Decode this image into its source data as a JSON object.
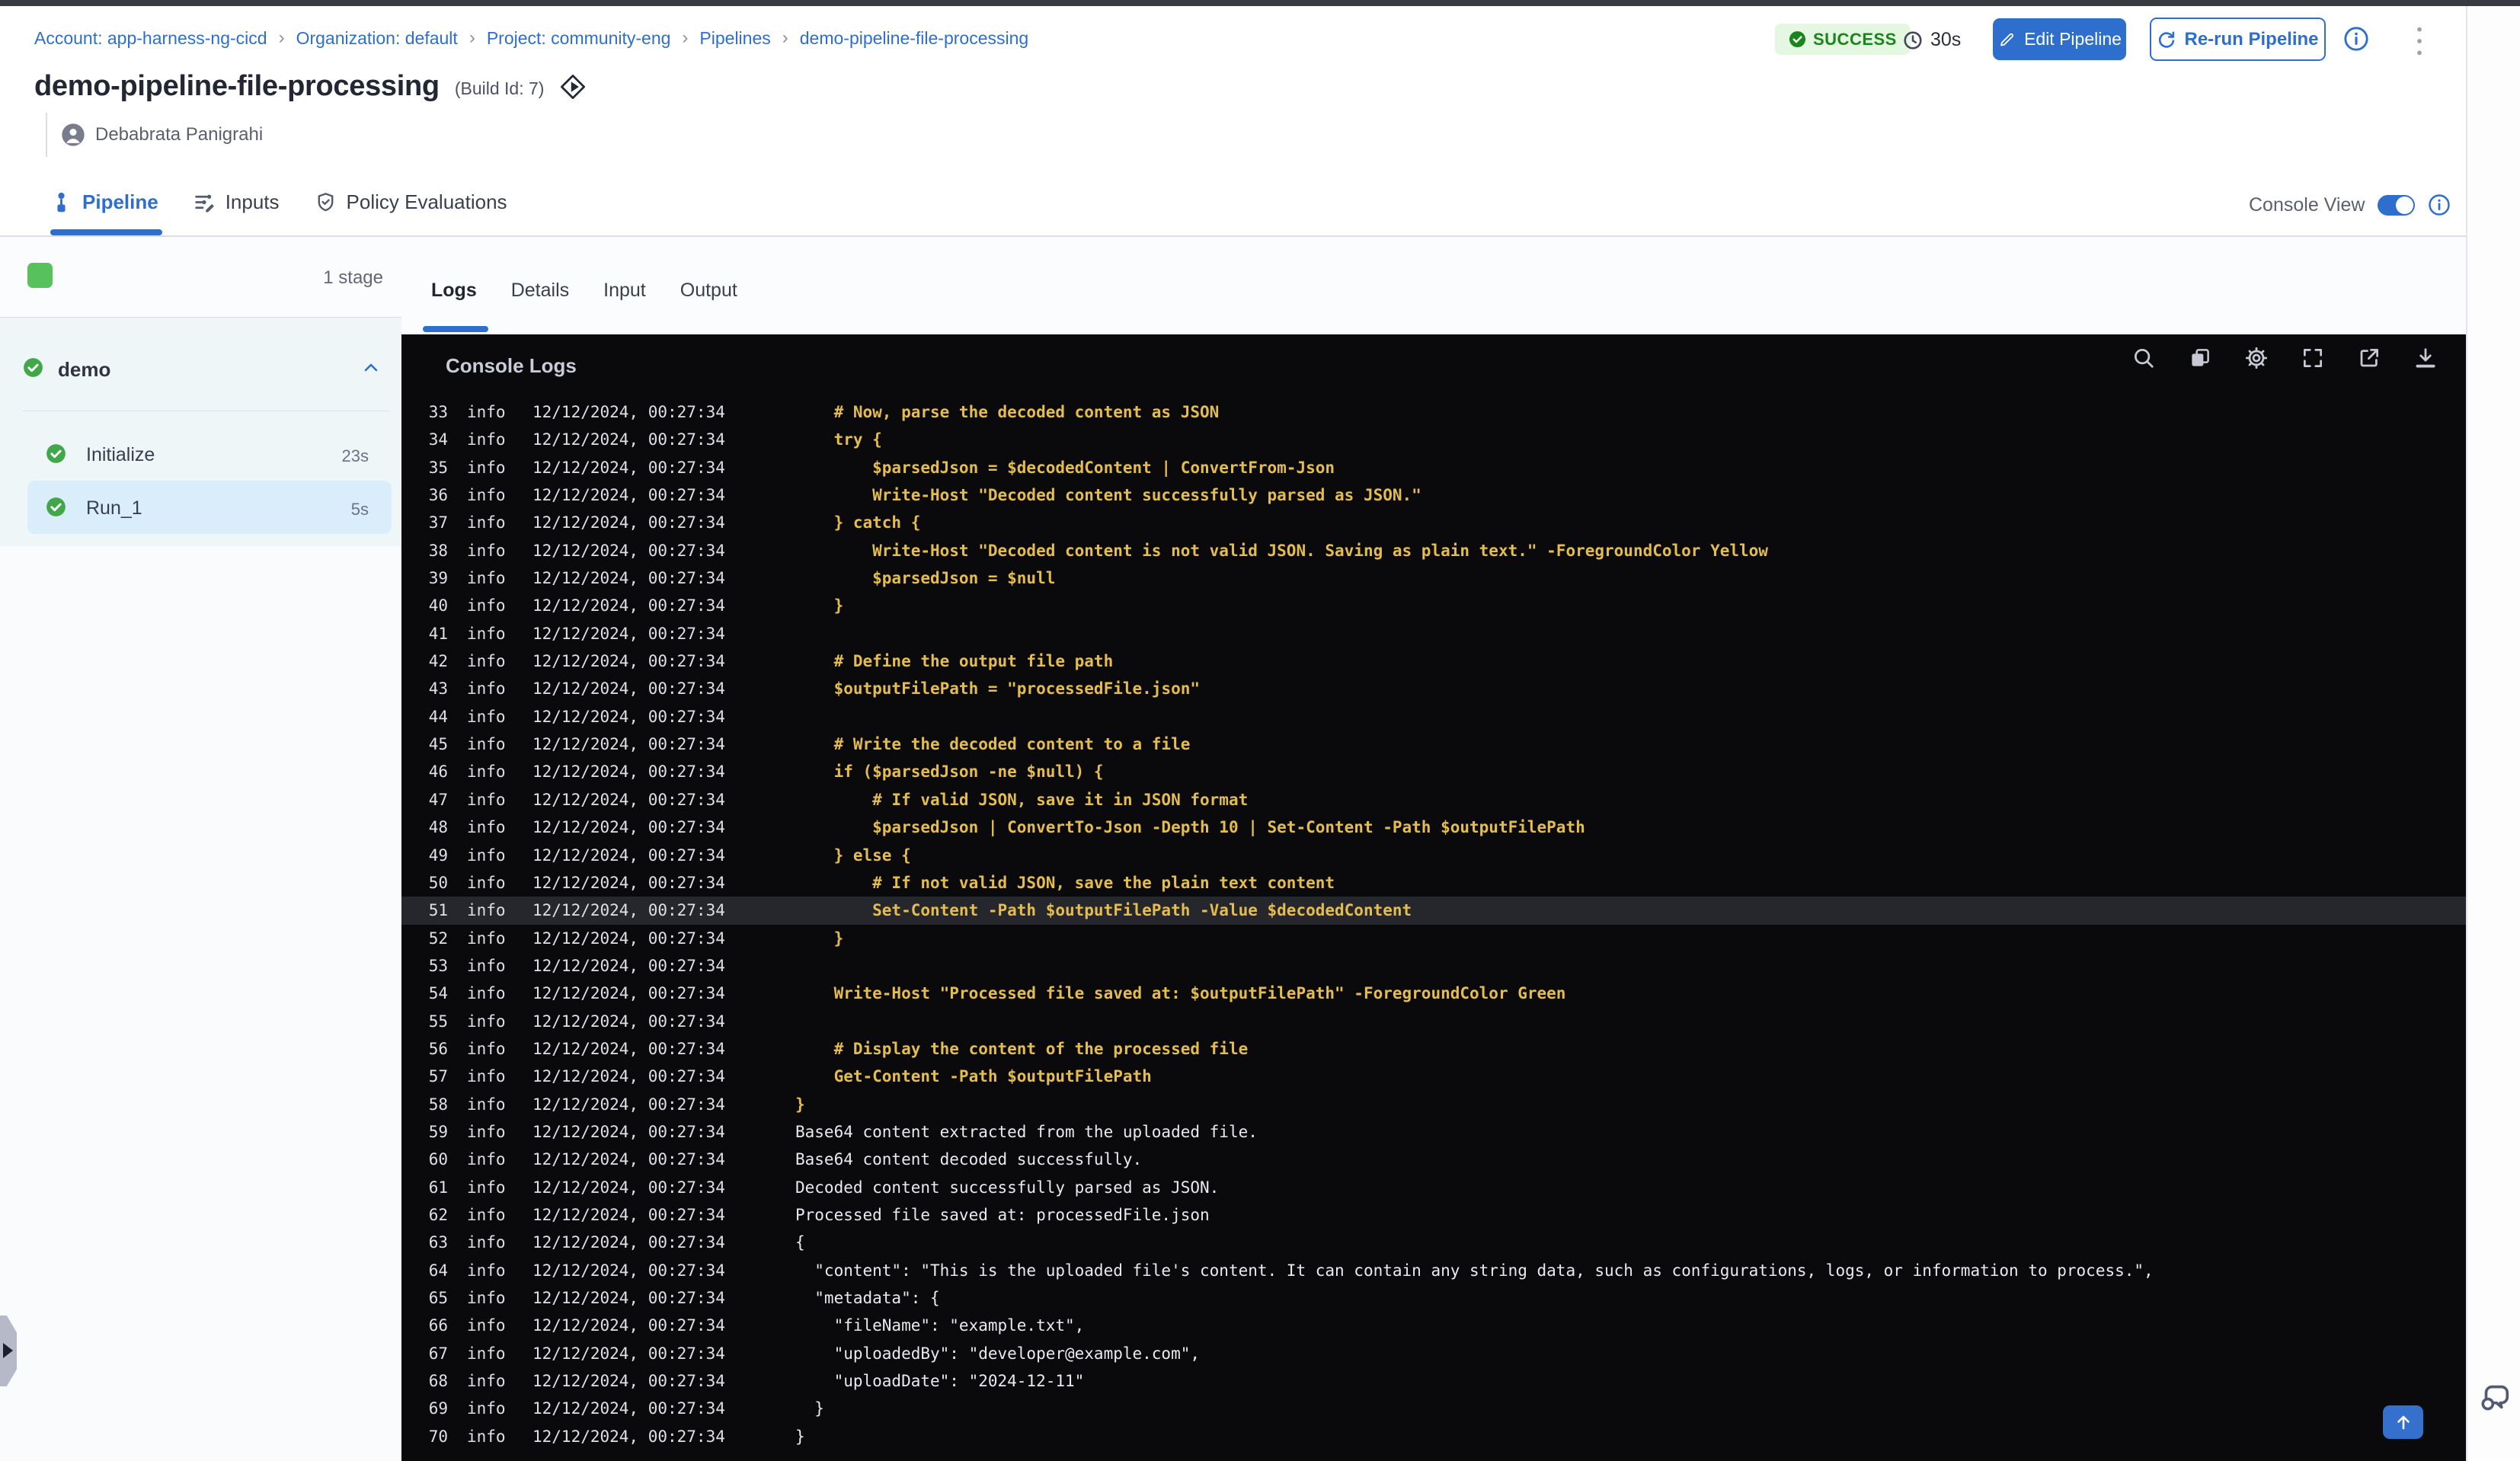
{
  "colors": {
    "brand": "#2e6ecd",
    "badge_bg": "#e4f7e0",
    "badge_text": "#1b841d",
    "icon_green": "#42a749",
    "stage_green": "#57c15b",
    "panel_cyan": "#eef6f7",
    "selected_step": "#d9edfb",
    "console_bg": "#0a0a0d",
    "code_yellow": "#e4bd4e",
    "log_white": "#e9eaef",
    "log_meta": "#dfe0e6",
    "highlight_row": "#25272d",
    "divider": "#dcdde8"
  },
  "breadcrumb": {
    "separator": "›",
    "items": [
      "Account: app-harness-ng-cicd",
      "Organization: default",
      "Project: community-eng",
      "Pipelines",
      "demo-pipeline-file-processing"
    ]
  },
  "header": {
    "status": "SUCCESS",
    "duration": "30s",
    "edit_button": "Edit Pipeline",
    "rerun_button": "Re-run Pipeline",
    "title": "demo-pipeline-file-processing",
    "build_id": "(Build Id: 7)",
    "user": "Debabrata Panigrahi"
  },
  "main_tabs": {
    "items": [
      {
        "label": "Pipeline",
        "icon": "pipeline-icon",
        "active": true
      },
      {
        "label": "Inputs",
        "icon": "inputs-icon",
        "active": false
      },
      {
        "label": "Policy Evaluations",
        "icon": "policy-icon",
        "active": false
      }
    ]
  },
  "console_view": {
    "label": "Console View",
    "enabled": true
  },
  "stage_panel": {
    "stage_count_label": "1 stage",
    "group": {
      "name": "demo",
      "status": "success"
    },
    "steps": [
      {
        "name": "Initialize",
        "duration": "23s",
        "selected": false
      },
      {
        "name": "Run_1",
        "duration": "5s",
        "selected": true
      }
    ]
  },
  "log_tabs": {
    "items": [
      {
        "label": "Logs",
        "active": true
      },
      {
        "label": "Details",
        "active": false
      },
      {
        "label": "Input",
        "active": false
      },
      {
        "label": "Output",
        "active": false
      }
    ]
  },
  "console": {
    "title": "Console Logs",
    "toolbar_icons": [
      "search",
      "copy",
      "settings",
      "fullscreen",
      "open-in-new",
      "download"
    ],
    "level": "info",
    "timestamp": "12/12/2024, 00:27:34",
    "lines": [
      {
        "n": 33,
        "tone": "code",
        "text": "    # Now, parse the decoded content as JSON"
      },
      {
        "n": 34,
        "tone": "code",
        "text": "    try {"
      },
      {
        "n": 35,
        "tone": "code",
        "text": "        $parsedJson = $decodedContent | ConvertFrom-Json"
      },
      {
        "n": 36,
        "tone": "code",
        "text": "        Write-Host \"Decoded content successfully parsed as JSON.\""
      },
      {
        "n": 37,
        "tone": "code",
        "text": "    } catch {"
      },
      {
        "n": 38,
        "tone": "code",
        "text": "        Write-Host \"Decoded content is not valid JSON. Saving as plain text.\" -ForegroundColor Yellow"
      },
      {
        "n": 39,
        "tone": "code",
        "text": "        $parsedJson = $null"
      },
      {
        "n": 40,
        "tone": "code",
        "text": "    }"
      },
      {
        "n": 41,
        "tone": "code",
        "text": ""
      },
      {
        "n": 42,
        "tone": "code",
        "text": "    # Define the output file path"
      },
      {
        "n": 43,
        "tone": "code",
        "text": "    $outputFilePath = \"processedFile.json\""
      },
      {
        "n": 44,
        "tone": "code",
        "text": ""
      },
      {
        "n": 45,
        "tone": "code",
        "text": "    # Write the decoded content to a file"
      },
      {
        "n": 46,
        "tone": "code",
        "text": "    if ($parsedJson -ne $null) {"
      },
      {
        "n": 47,
        "tone": "code",
        "text": "        # If valid JSON, save it in JSON format"
      },
      {
        "n": 48,
        "tone": "code",
        "text": "        $parsedJson | ConvertTo-Json -Depth 10 | Set-Content -Path $outputFilePath"
      },
      {
        "n": 49,
        "tone": "code",
        "text": "    } else {"
      },
      {
        "n": 50,
        "tone": "code",
        "text": "        # If not valid JSON, save the plain text content"
      },
      {
        "n": 51,
        "tone": "code",
        "highlight": true,
        "text": "        Set-Content -Path $outputFilePath -Value $decodedContent"
      },
      {
        "n": 52,
        "tone": "code",
        "text": "    }"
      },
      {
        "n": 53,
        "tone": "code",
        "text": ""
      },
      {
        "n": 54,
        "tone": "code",
        "text": "    Write-Host \"Processed file saved at: $outputFilePath\" -ForegroundColor Green"
      },
      {
        "n": 55,
        "tone": "code",
        "text": ""
      },
      {
        "n": 56,
        "tone": "code",
        "text": "    # Display the content of the processed file"
      },
      {
        "n": 57,
        "tone": "code",
        "text": "    Get-Content -Path $outputFilePath"
      },
      {
        "n": 58,
        "tone": "code",
        "text": "}"
      },
      {
        "n": 59,
        "tone": "out",
        "text": "Base64 content extracted from the uploaded file."
      },
      {
        "n": 60,
        "tone": "out",
        "text": "Base64 content decoded successfully."
      },
      {
        "n": 61,
        "tone": "out",
        "text": "Decoded content successfully parsed as JSON."
      },
      {
        "n": 62,
        "tone": "out",
        "text": "Processed file saved at: processedFile.json"
      },
      {
        "n": 63,
        "tone": "out",
        "text": "{"
      },
      {
        "n": 64,
        "tone": "out",
        "text": "  \"content\": \"This is the uploaded file's content. It can contain any string data, such as configurations, logs, or information to process.\","
      },
      {
        "n": 65,
        "tone": "out",
        "text": "  \"metadata\": {"
      },
      {
        "n": 66,
        "tone": "out",
        "text": "    \"fileName\": \"example.txt\","
      },
      {
        "n": 67,
        "tone": "out",
        "text": "    \"uploadedBy\": \"developer@example.com\","
      },
      {
        "n": 68,
        "tone": "out",
        "text": "    \"uploadDate\": \"2024-12-11\""
      },
      {
        "n": 69,
        "tone": "out",
        "text": "  }"
      },
      {
        "n": 70,
        "tone": "out",
        "text": "}"
      }
    ]
  }
}
